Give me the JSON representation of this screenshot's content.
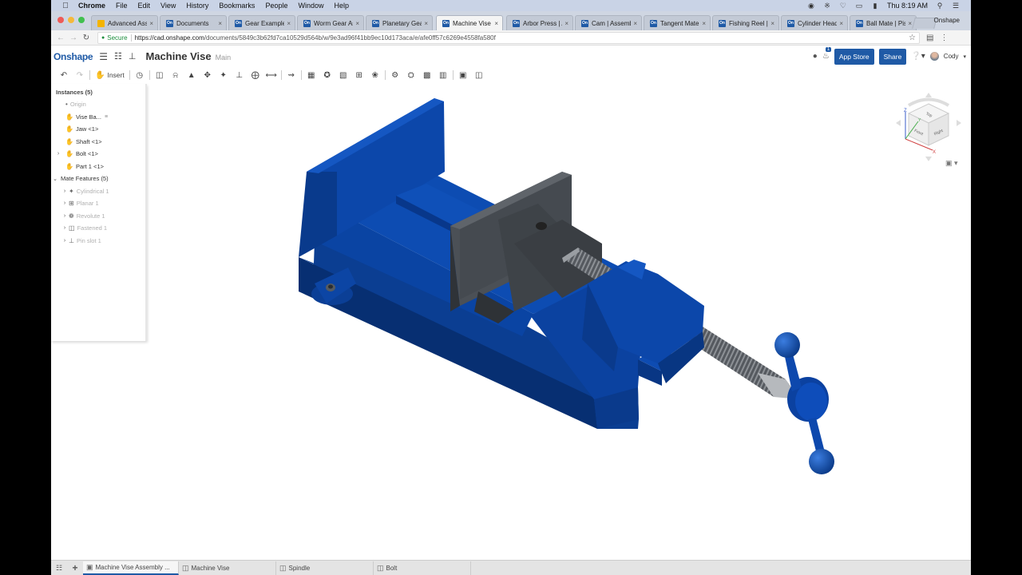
{
  "menubar": {
    "apple": "",
    "items": [
      "Chrome",
      "File",
      "Edit",
      "View",
      "History",
      "Bookmarks",
      "People",
      "Window",
      "Help"
    ],
    "clock": "Thu 8:19 AM"
  },
  "browser": {
    "tabs": [
      {
        "label": "Advanced Asse",
        "icon": "slides"
      },
      {
        "label": "Documents",
        "icon": "onshape"
      },
      {
        "label": "Gear Example |",
        "icon": "onshape"
      },
      {
        "label": "Worm Gear Ass",
        "icon": "onshape"
      },
      {
        "label": "Planetary Gear",
        "icon": "onshape"
      },
      {
        "label": "Machine Vise | ",
        "icon": "onshape",
        "active": true
      },
      {
        "label": "Arbor Press | A",
        "icon": "onshape"
      },
      {
        "label": "Cam | Assembly",
        "icon": "onshape"
      },
      {
        "label": "Tangent Mate E",
        "icon": "onshape"
      },
      {
        "label": "Fishing Reel | F",
        "icon": "onshape"
      },
      {
        "label": "Cylinder Head",
        "icon": "onshape"
      },
      {
        "label": "Ball Mate | Pist",
        "icon": "onshape"
      }
    ],
    "profile": "Onshape",
    "secure_label": "Secure",
    "url_host": "https://cad.onshape.com",
    "url_path": "/documents/5849c3b62fd7ca10529d564b/w/9e3ad96f41bb9ec10d173aca/e/afe0ff57c6269e4558fa580f"
  },
  "header": {
    "logo": "Onshape",
    "doc_title": "Machine Vise",
    "branch": "Main",
    "notification_count": "1",
    "app_store": "App Store",
    "share": "Share",
    "user": "Cody"
  },
  "toolbar": {
    "insert_label": "Insert",
    "icons": [
      "undo-icon",
      "redo-icon",
      "insert-icon",
      "history-icon",
      "fastened-mate-icon",
      "revolute-mate-icon",
      "slider-mate-icon",
      "planar-mate-icon",
      "cylindrical-mate-icon",
      "pin-slot-mate-icon",
      "ball-mate-icon",
      "parallel-mate-icon",
      "tangent-mate-icon",
      "mate-connector-icon",
      "group-icon",
      "replicate-icon",
      "linear-pattern-icon",
      "circular-pattern-icon",
      "gear-relation-icon",
      "rack-pinion-icon",
      "screw-relation-icon",
      "linear-relation-icon",
      "explode-icon",
      "section-view-icon"
    ]
  },
  "instances": {
    "header": "Instances (5)",
    "items": [
      {
        "label": "Origin",
        "muted": true,
        "type": "origin"
      },
      {
        "label": "Vise Ba...",
        "type": "part",
        "fixed": true
      },
      {
        "label": "Jaw <1>",
        "type": "part"
      },
      {
        "label": "Shaft <1>",
        "type": "part"
      },
      {
        "label": "Bolt <1>",
        "type": "part",
        "expandable": true
      },
      {
        "label": "Part 1 <1>",
        "type": "part"
      }
    ],
    "mates_header": "Mate Features (5)",
    "mates": [
      {
        "label": "Cylindrical 1",
        "icon": "cylindrical-mate-icon"
      },
      {
        "label": "Planar 1",
        "icon": "planar-mate-icon"
      },
      {
        "label": "Revolute 1",
        "icon": "revolute-mate-icon"
      },
      {
        "label": "Fastened 1",
        "icon": "fastened-mate-icon"
      },
      {
        "label": "Pin slot 1",
        "icon": "pin-slot-mate-icon"
      }
    ]
  },
  "viewcube": {
    "top": "Top",
    "front": "Front",
    "right": "Right",
    "axis_x": "X",
    "axis_y": "Y",
    "axis_z": "Z"
  },
  "bottom_tabs": [
    {
      "label": "Machine Vise Assembly ...",
      "type": "assembly",
      "active": true
    },
    {
      "label": "Machine Vise",
      "type": "partstudio"
    },
    {
      "label": "Spindle",
      "type": "partstudio"
    },
    {
      "label": "Bolt",
      "type": "partstudio"
    }
  ],
  "colors": {
    "brand": "#1f5aa6",
    "vise_blue": "#0a47a8",
    "jaw_gray": "#4a4f55"
  }
}
